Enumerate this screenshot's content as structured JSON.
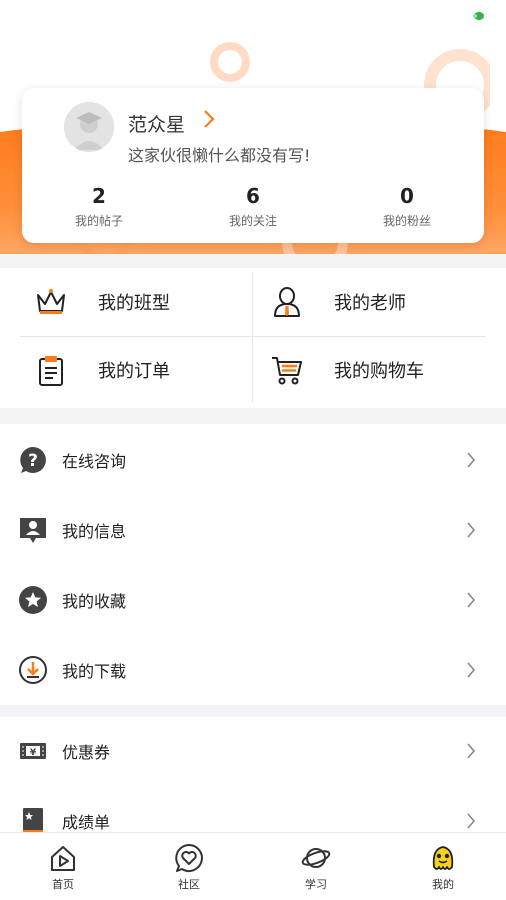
{
  "colors": {
    "accent": "#ff7a1a",
    "accent_light": "#ffb27a",
    "status_green": "#2fb54a",
    "separator": "#f4f4f6"
  },
  "profile": {
    "username": "范众星",
    "bio": "这家伙很懒什么都没有写!",
    "stats": [
      {
        "value": "2",
        "label": "我的帖子"
      },
      {
        "value": "6",
        "label": "我的关注"
      },
      {
        "value": "0",
        "label": "我的粉丝"
      }
    ]
  },
  "grid": [
    {
      "label": "我的班型",
      "icon": "crown-icon"
    },
    {
      "label": "我的老师",
      "icon": "teacher-icon"
    },
    {
      "label": "我的订单",
      "icon": "clipboard-icon"
    },
    {
      "label": "我的购物车",
      "icon": "cart-icon"
    }
  ],
  "menu_group1": [
    {
      "label": "在线咨询",
      "icon": "question-icon"
    },
    {
      "label": "我的信息",
      "icon": "user-card-icon"
    },
    {
      "label": "我的收藏",
      "icon": "star-icon"
    },
    {
      "label": "我的下载",
      "icon": "download-icon"
    }
  ],
  "menu_group2": [
    {
      "label": "优惠券",
      "icon": "coupon-icon"
    },
    {
      "label": "成绩单",
      "icon": "transcript-icon"
    }
  ],
  "tabs": [
    {
      "label": "首页",
      "icon": "home-icon"
    },
    {
      "label": "社区",
      "icon": "community-heart-icon"
    },
    {
      "label": "学习",
      "icon": "planet-icon"
    },
    {
      "label": "我的",
      "icon": "mascot-icon",
      "active": true
    }
  ]
}
